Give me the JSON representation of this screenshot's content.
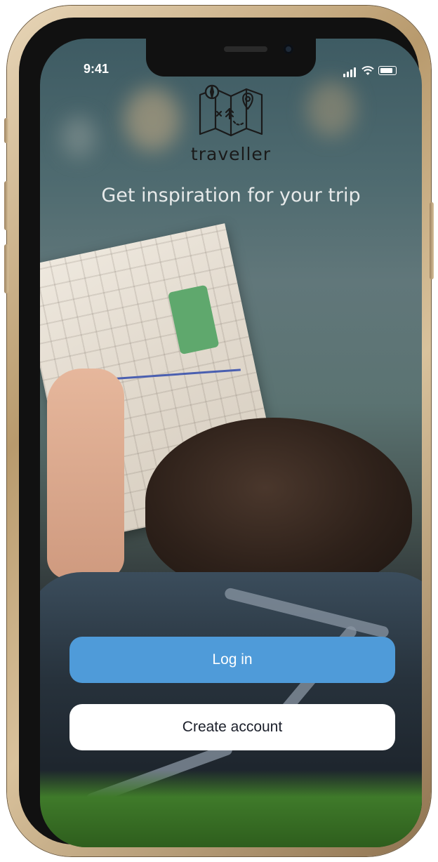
{
  "status_bar": {
    "time": "9:41"
  },
  "brand": {
    "name": "traveller",
    "logo_icon": "folded-map-compass-pin-icon"
  },
  "hero": {
    "tagline": "Get inspiration for your trip"
  },
  "actions": {
    "login_label": "Log in",
    "create_account_label": "Create account"
  },
  "colors": {
    "primary_button": "#4f9bd9",
    "secondary_button": "#ffffff",
    "tagline_text": "#e7eaea",
    "brand_text": "#1a1a1a"
  }
}
